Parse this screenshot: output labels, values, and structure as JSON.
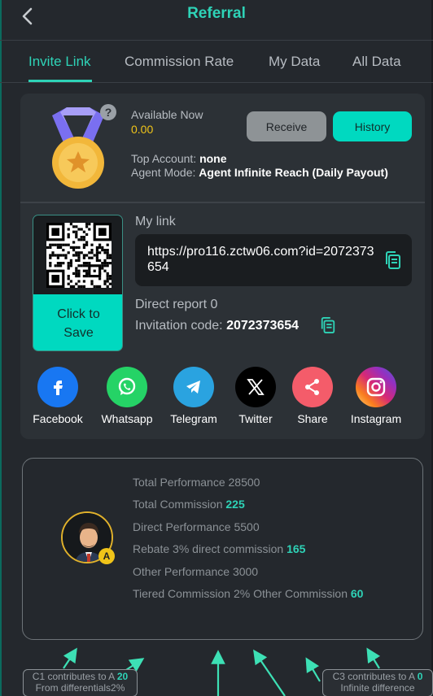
{
  "header": {
    "title": "Referral"
  },
  "tabs": [
    {
      "label": "Invite Link",
      "active": true
    },
    {
      "label": "Commission Rate"
    },
    {
      "label": "My Data"
    },
    {
      "label": "All Data"
    }
  ],
  "account": {
    "available_label": "Available Now",
    "available_value": "0.00",
    "receive_label": "Receive",
    "history_label": "History",
    "top_account_label": "Top Account:",
    "top_account_value": "none",
    "agent_mode_label": "Agent Mode:",
    "agent_mode_value": "Agent Infinite Reach (Daily Payout)"
  },
  "qr": {
    "save_label": "Click to Save"
  },
  "link": {
    "label": "My link",
    "url": "https://pro116.zctw06.com?id=2072373654",
    "direct_report": "Direct report 0",
    "invite_label": "Invitation code:",
    "invite_code": "2072373654"
  },
  "share": [
    {
      "label": "Facebook",
      "icon": "facebook-icon",
      "color": "#1877f2"
    },
    {
      "label": "Whatsapp",
      "icon": "whatsapp-icon",
      "color": "#25d366"
    },
    {
      "label": "Telegram",
      "icon": "telegram-icon",
      "color": "#2aa3e0"
    },
    {
      "label": "Twitter",
      "icon": "x-icon",
      "color": "#000000"
    },
    {
      "label": "Share",
      "icon": "share-icon",
      "color": "#f45c6a"
    },
    {
      "label": "Instagram",
      "icon": "instagram-icon",
      "color": "#d6249f"
    }
  ],
  "performance": {
    "avatar_badge": "A",
    "total_performance": "Total Performance 28500",
    "total_commission_label": "Total Commission",
    "total_commission_value": "225",
    "direct_performance": "Direct Performance 5500",
    "rebate_label": "Rebate 3% direct commission",
    "rebate_value": "165",
    "other_performance": "Other Performance 3000",
    "tiered_label": "Tiered Commission 2% Other Commission",
    "tiered_value": "60"
  },
  "tags": {
    "c1_line1": "C1 contributes to A",
    "c1_value": "20",
    "c1_line2": "From differentials2%",
    "c3_line1": "C3 contributes to A",
    "c3_value": "0",
    "c3_line2": "Infinite difference"
  },
  "colors": {
    "accent": "#2ed3b7",
    "button": "#00d9c0",
    "gold": "#f0c419",
    "background": "#24282d"
  }
}
